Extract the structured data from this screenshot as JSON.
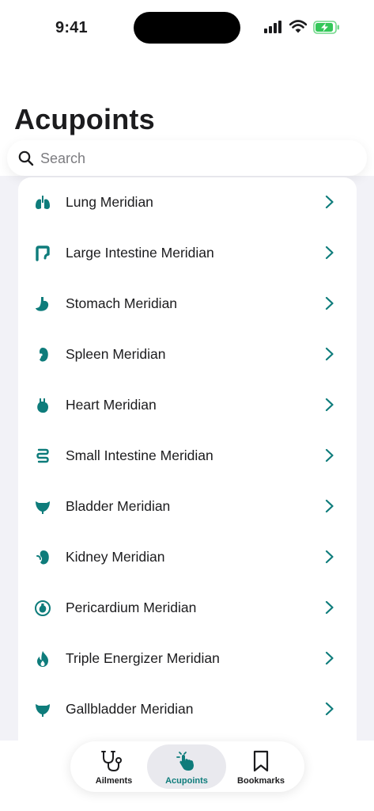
{
  "status_bar": {
    "time": "9:41"
  },
  "title": "Acupoints",
  "search": {
    "placeholder": "Search",
    "value": ""
  },
  "colors": {
    "accent": "#0e7c7b",
    "battery_green": "#34c759"
  },
  "meridians": [
    {
      "label": "Lung Meridian",
      "icon": "lungs-icon"
    },
    {
      "label": "Large Intestine Meridian",
      "icon": "large-intestine-icon"
    },
    {
      "label": "Stomach Meridian",
      "icon": "stomach-icon"
    },
    {
      "label": "Spleen Meridian",
      "icon": "spleen-icon"
    },
    {
      "label": "Heart Meridian",
      "icon": "heart-organ-icon"
    },
    {
      "label": "Small Intestine Meridian",
      "icon": "small-intestine-icon"
    },
    {
      "label": "Bladder Meridian",
      "icon": "bladder-icon"
    },
    {
      "label": "Kidney Meridian",
      "icon": "kidney-icon"
    },
    {
      "label": "Pericardium Meridian",
      "icon": "pericardium-icon"
    },
    {
      "label": "Triple Energizer Meridian",
      "icon": "flame-icon"
    },
    {
      "label": "Gallbladder Meridian",
      "icon": "gallbladder-icon"
    }
  ],
  "tabs": [
    {
      "label": "Ailments",
      "icon": "stethoscope-icon",
      "active": false
    },
    {
      "label": "Acupoints",
      "icon": "pointing-hand-icon",
      "active": true
    },
    {
      "label": "Bookmarks",
      "icon": "bookmark-icon",
      "active": false
    }
  ]
}
